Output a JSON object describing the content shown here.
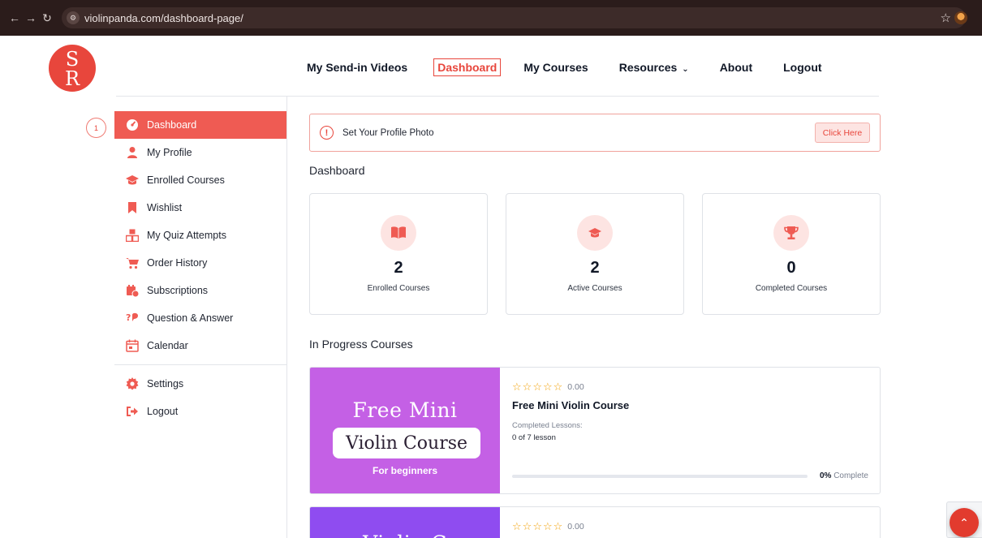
{
  "browser": {
    "url": "violinpanda.com/dashboard-page/",
    "site_info_icon": "tune-icon"
  },
  "logo": {
    "letters": "SR"
  },
  "nav": {
    "items": [
      {
        "label": "My Send-in Videos"
      },
      {
        "label": "Dashboard",
        "active": true
      },
      {
        "label": "My Courses"
      },
      {
        "label": "Resources"
      },
      {
        "label": "About"
      },
      {
        "label": "Logout"
      }
    ]
  },
  "step_badge": "1",
  "sidebar": {
    "items": [
      {
        "label": "Dashboard",
        "icon": "speedometer-icon",
        "active": true
      },
      {
        "label": "My Profile",
        "icon": "user-icon"
      },
      {
        "label": "Enrolled Courses",
        "icon": "graduation-cap-icon"
      },
      {
        "label": "Wishlist",
        "icon": "bookmark-icon"
      },
      {
        "label": "My Quiz Attempts",
        "icon": "quiz-blocks-icon"
      },
      {
        "label": "Order History",
        "icon": "cart-icon"
      },
      {
        "label": "Subscriptions",
        "icon": "subscription-icon"
      },
      {
        "label": "Question & Answer",
        "icon": "question-answer-icon"
      },
      {
        "label": "Calendar",
        "icon": "calendar-icon"
      }
    ],
    "bottom_items": [
      {
        "label": "Settings",
        "icon": "gear-icon"
      },
      {
        "label": "Logout",
        "icon": "logout-icon"
      }
    ]
  },
  "alert": {
    "text": "Set Your Profile Photo",
    "button": "Click Here"
  },
  "dashboard": {
    "title": "Dashboard",
    "stats": [
      {
        "value": "2",
        "label": "Enrolled Courses",
        "icon": "book-icon"
      },
      {
        "value": "2",
        "label": "Active Courses",
        "icon": "graduation-cap-icon"
      },
      {
        "value": "0",
        "label": "Completed Courses",
        "icon": "trophy-icon"
      }
    ]
  },
  "in_progress": {
    "title": "In Progress Courses",
    "courses": [
      {
        "thumb_line1": "Free Mini",
        "thumb_line2": "Violin Course",
        "thumb_sub": "For beginners",
        "rating": "0.00",
        "title": "Free Mini Violin Course",
        "lessons_label": "Completed Lessons:",
        "lessons_value": "0 of 7 lesson",
        "progress_percent": "0%",
        "progress_word": "Complete"
      },
      {
        "thumb_line1": "Violin C",
        "rating": "0.00"
      }
    ]
  },
  "colors": {
    "accent": "#ef5b53",
    "brand_red": "#e8463c",
    "star": "#f2a20a",
    "thumb_purple": "#c460e5",
    "thumb_violet": "#8f4cf0"
  }
}
